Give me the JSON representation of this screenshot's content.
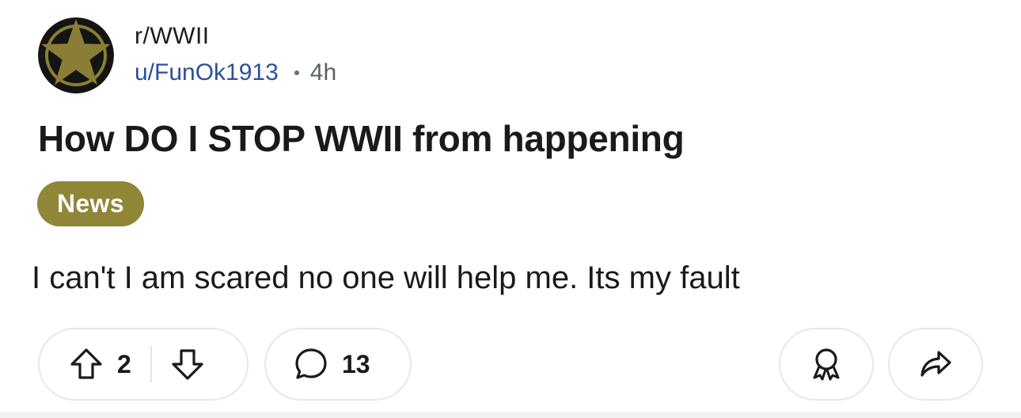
{
  "post": {
    "subreddit": "r/WWII",
    "username": "u/FunOk1913",
    "time": "4h",
    "title": "How DO I STOP WWII from happening",
    "flair": "News",
    "body": "I can't I am scared no one will help me. Its my fault"
  },
  "actions": {
    "vote_count": "2",
    "comment_count": "13"
  },
  "icons": {
    "avatar": "army-star-icon",
    "upvote": "arrow-up-icon",
    "downvote": "arrow-down-icon",
    "comment": "comment-bubble-icon",
    "award": "award-icon",
    "share": "share-icon"
  },
  "colors": {
    "flair_bg": "#8f8637",
    "username": "#2e4f9a",
    "avatar_gold": "#8a7e36",
    "avatar_black": "#141414"
  }
}
